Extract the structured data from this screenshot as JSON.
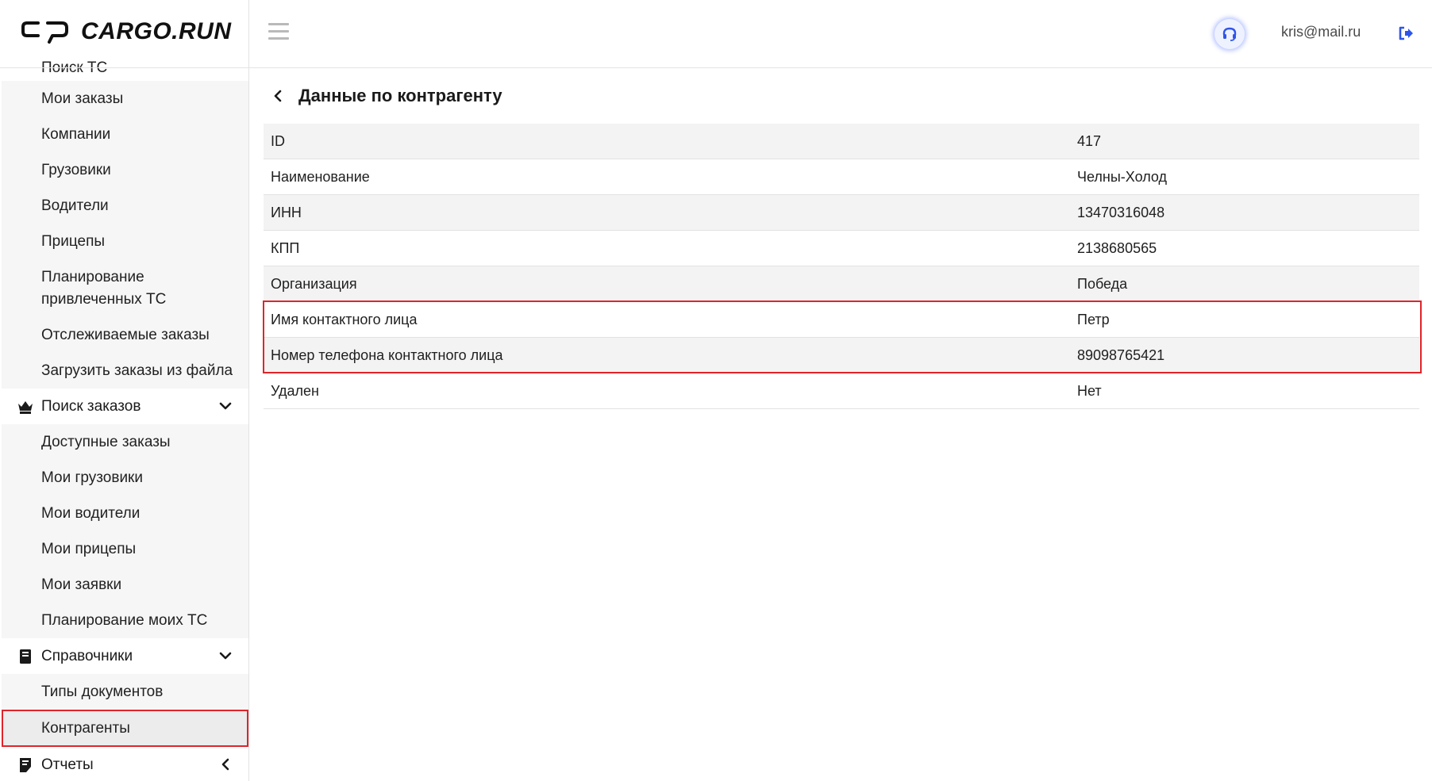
{
  "app": {
    "brand": "CARGO.RUN"
  },
  "header": {
    "user_email": "kris@mail.ru"
  },
  "sidebar": {
    "cut_item": "Поиск ТС",
    "block1": [
      "Мои заказы",
      "Компании",
      "Грузовики",
      "Водители",
      "Прицепы",
      "Планирование привлеченных ТС",
      "Отслеживаемые заказы",
      "Загрузить заказы из файла"
    ],
    "group_orders": "Поиск заказов",
    "block2": [
      "Доступные заказы",
      "Мои грузовики",
      "Мои водители",
      "Мои прицепы",
      "Мои заявки",
      "Планирование моих ТС"
    ],
    "group_refs": "Справочники",
    "block3": [
      "Типы документов",
      "Контрагенты"
    ],
    "group_reports": "Отчеты"
  },
  "page": {
    "title": "Данные по контрагенту",
    "rows": [
      {
        "label": "ID",
        "value": "417"
      },
      {
        "label": "Наименование",
        "value": "Челны-Холод"
      },
      {
        "label": "ИНН",
        "value": "13470316048"
      },
      {
        "label": "КПП",
        "value": "2138680565"
      },
      {
        "label": "Организация",
        "value": "Победа"
      },
      {
        "label": "Имя контактного лица",
        "value": "Петр"
      },
      {
        "label": "Номер телефона контактного лица",
        "value": "89098765421"
      },
      {
        "label": "Удален",
        "value": "Нет"
      }
    ]
  },
  "colors": {
    "highlight": "#e0242b",
    "accent": "#2f55e8"
  }
}
